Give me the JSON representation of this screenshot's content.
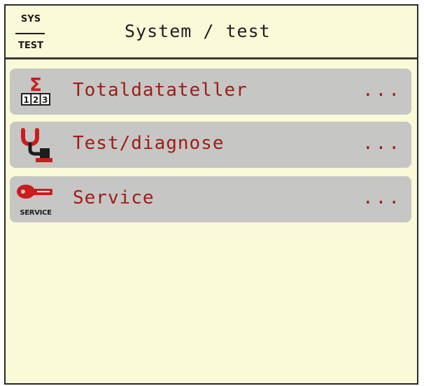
{
  "header": {
    "badge_top": "SYS",
    "badge_bottom": "TEST",
    "title": "System / test"
  },
  "menu": {
    "items": [
      {
        "label": "Totaldatateller",
        "more": "...",
        "icon": "sum-counter-icon"
      },
      {
        "label": "Test/diagnose",
        "more": "...",
        "icon": "diagnostics-icon"
      },
      {
        "label": "Service",
        "more": "...",
        "icon": "service-key-icon",
        "icon_text": "SERVICE"
      }
    ]
  },
  "colors": {
    "background": "#fafad9",
    "item_background": "#c6c6c4",
    "label_color": "#9e1c16",
    "icon_red": "#c81e1e"
  }
}
